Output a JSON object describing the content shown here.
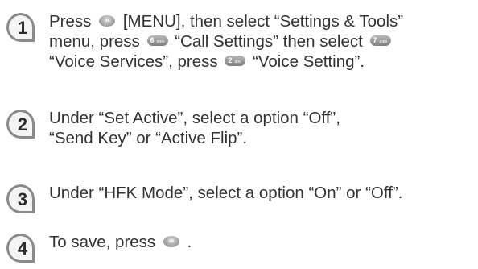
{
  "steps": [
    {
      "number": "1",
      "lines": [
        [
          "Press",
          " [MENU], then select “Settings & Tools”"
        ],
        [
          "menu, press",
          "“Call Settings” then select",
          ""
        ],
        [
          "“Voice Services”, press",
          "“Voice Setting”."
        ]
      ],
      "keys": {
        "ok": "ok",
        "k6_digit": "6",
        "k6_letters": "mno",
        "k7_digit": "7",
        "k7_letters": "pqrs",
        "k2_digit": "2",
        "k2_letters": "abc"
      }
    },
    {
      "number": "2",
      "lines": [
        "Under “Set Active”, select a option “Off”,",
        "“Send Key” or “Active Flip”."
      ]
    },
    {
      "number": "3",
      "lines": [
        "Under “HFK Mode”, select a option “On” or “Off”."
      ]
    },
    {
      "number": "4",
      "lines": [
        [
          "To save, press",
          "."
        ]
      ],
      "keys": {
        "ok": "ok"
      }
    }
  ],
  "colors": {
    "badge_fill": "#8a8a8a",
    "badge_dark": "#5c5c5c",
    "text": "#333333"
  },
  "icons": [
    "number-badge-icon",
    "ok-key-icon",
    "key-6-icon",
    "key-7-icon",
    "key-2-icon"
  ]
}
